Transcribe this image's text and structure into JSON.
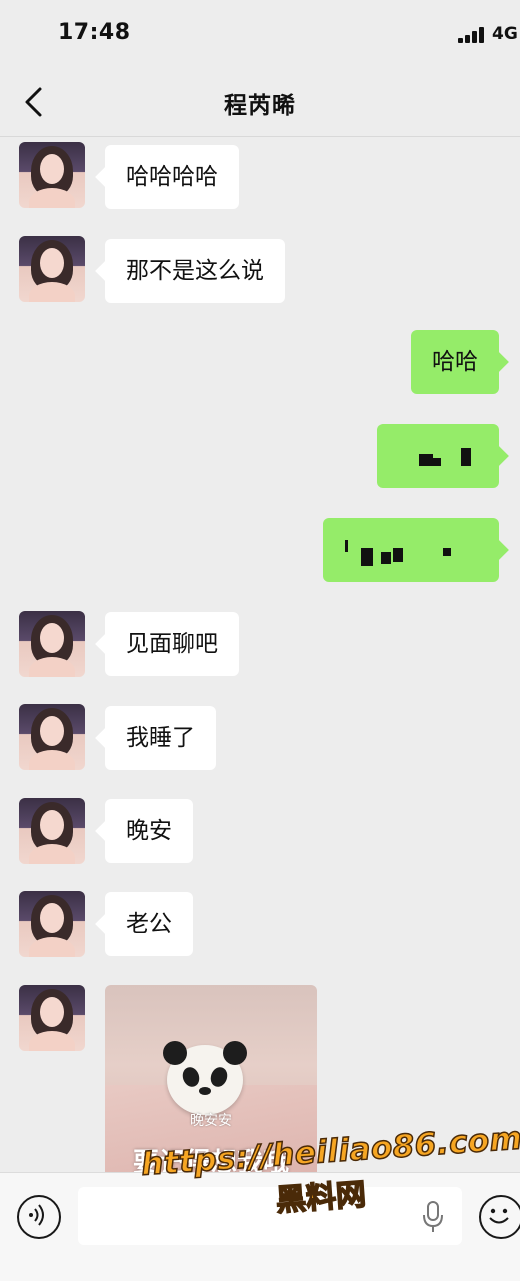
{
  "status_bar": {
    "time": "17:48",
    "network": "4G"
  },
  "header": {
    "title": "程芮晞"
  },
  "messages": [
    {
      "side": "in",
      "text": "哈哈哈哈"
    },
    {
      "side": "in",
      "text": "那不是这么说"
    },
    {
      "side": "out",
      "text": "哈哈"
    },
    {
      "side": "out",
      "text": ""
    },
    {
      "side": "out",
      "text": ""
    },
    {
      "side": "in",
      "text": "见面聊吧"
    },
    {
      "side": "in",
      "text": "我睡了"
    },
    {
      "side": "in",
      "text": "晚安"
    },
    {
      "side": "in",
      "text": "老公"
    },
    {
      "side": "in",
      "type": "image",
      "caption_small": "晚安安",
      "caption_big": "要记得想我哦"
    }
  ],
  "input": {
    "value": "",
    "placeholder": ""
  },
  "watermark": {
    "url": "https://heiliao86.com",
    "text": "黑料网"
  },
  "colors": {
    "outgoing_bubble": "#95ec69",
    "incoming_bubble": "#ffffff",
    "background": "#ededed"
  },
  "icons": [
    "back-icon",
    "voice-icon",
    "mic-icon",
    "emoji-icon",
    "signal-icon"
  ]
}
